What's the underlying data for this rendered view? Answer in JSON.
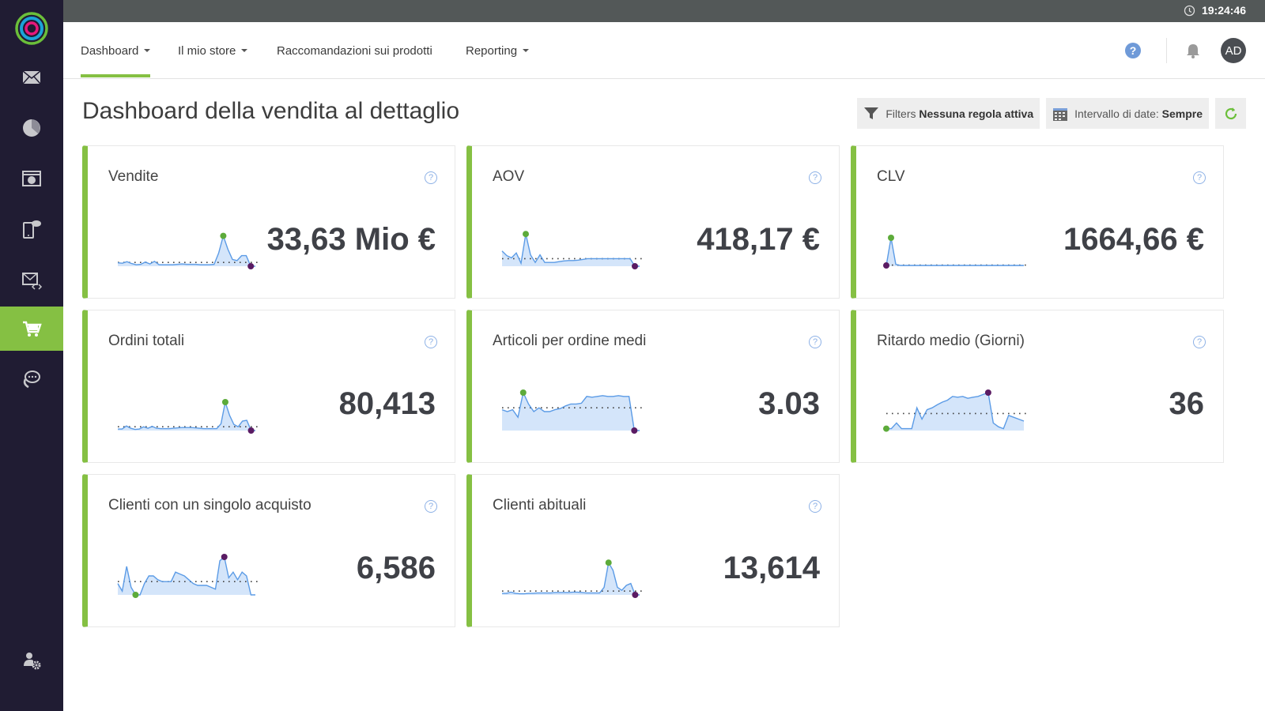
{
  "sidebar": {
    "items": [
      {
        "name": "email",
        "icon": "envelope-icon"
      },
      {
        "name": "analytics",
        "icon": "pie-chart-icon"
      },
      {
        "name": "web-overlay",
        "icon": "browser-window-icon"
      },
      {
        "name": "mobile-push",
        "icon": "mobile-message-icon"
      },
      {
        "name": "email-code",
        "icon": "envelope-code-icon"
      },
      {
        "name": "ecommerce",
        "icon": "cart-icon",
        "active": true
      },
      {
        "name": "chat",
        "icon": "chat-bubble-icon"
      }
    ],
    "bottom": {
      "name": "user-settings",
      "icon": "user-gear-icon"
    }
  },
  "topbar": {
    "time": "19:24:46"
  },
  "nav": {
    "items": [
      {
        "label": "Dashboard",
        "dropdown": true,
        "active": true
      },
      {
        "label": "Il mio store",
        "dropdown": true
      },
      {
        "label": "Raccomandazioni sui prodotti",
        "dropdown": false
      },
      {
        "label": "Reporting",
        "dropdown": true
      }
    ],
    "help": "?",
    "avatar": "AD"
  },
  "page": {
    "title": "Dashboard della vendita al dettaglio",
    "filters_label": "Filters",
    "filters_value": "Nessuna regola attiva",
    "date_label": "Intervallo di date:",
    "date_value": "Sempre"
  },
  "colors": {
    "accent": "#85c043",
    "sidebar": "#201c33",
    "line": "#5b9be6",
    "area": "#d4e5fa",
    "max_dot": "#5dab3a",
    "min_dot": "#5a1b63"
  },
  "cards": [
    {
      "title": "Vendite",
      "value": "33,63 Mio €",
      "avg": 10,
      "max_color": "green",
      "series": [
        9,
        8,
        12,
        7,
        4,
        5,
        11,
        6,
        13,
        4,
        4,
        4,
        4,
        5,
        6,
        5,
        5,
        5,
        4,
        4,
        4,
        5,
        35,
        80,
        45,
        18,
        15,
        28,
        28,
        0,
        0
      ]
    },
    {
      "title": "AOV",
      "value": "418,17 €",
      "avg": 20,
      "max_color": "green",
      "series": [
        40,
        28,
        22,
        35,
        8,
        85,
        30,
        10,
        30,
        10,
        10,
        10,
        12,
        14,
        15,
        15,
        16,
        18,
        20,
        20,
        20,
        20,
        20,
        20,
        20,
        20,
        20,
        20,
        0,
        0
      ]
    },
    {
      "title": "CLV",
      "value": "1664,66 €",
      "avg": 3,
      "max_color": "green",
      "series": [
        2,
        75,
        5,
        2,
        2,
        2,
        2,
        2,
        2,
        2,
        2,
        2,
        2,
        2,
        2,
        2,
        2,
        2,
        2,
        2,
        2,
        2,
        2,
        2,
        2,
        2,
        2,
        2,
        2,
        2
      ]
    },
    {
      "title": "Ordini totali",
      "value": "80,413",
      "avg": 10,
      "max_color": "green",
      "series": [
        4,
        4,
        12,
        6,
        3,
        4,
        10,
        6,
        11,
        6,
        5,
        5,
        5,
        6,
        7,
        8,
        8,
        8,
        7,
        6,
        5,
        5,
        5,
        5,
        18,
        75,
        40,
        16,
        10,
        25,
        27,
        0,
        0
      ]
    },
    {
      "title": "Articoli per ordine medi",
      "value": "3.03",
      "avg": 60,
      "max_color": "green",
      "series": [
        55,
        50,
        55,
        35,
        100,
        70,
        50,
        60,
        50,
        50,
        55,
        58,
        65,
        70,
        70,
        72,
        90,
        88,
        90,
        92,
        90,
        90,
        92,
        90,
        90,
        0,
        0
      ]
    },
    {
      "title": "Ritardo medio (Giorni)",
      "value": "36",
      "avg": 45,
      "max_color": "purple",
      "invert": true,
      "series": [
        5,
        5,
        20,
        5,
        5,
        5,
        60,
        30,
        55,
        60,
        68,
        75,
        80,
        90,
        88,
        90,
        85,
        88,
        90,
        95,
        100,
        20,
        10,
        5,
        40,
        35,
        30,
        25
      ]
    },
    {
      "title": "Clienti con un singolo acquisto",
      "value": "6,586",
      "avg": 35,
      "max_color": "purple",
      "invert": true,
      "series": [
        30,
        10,
        75,
        20,
        0,
        0,
        30,
        50,
        50,
        40,
        35,
        35,
        35,
        60,
        55,
        50,
        40,
        30,
        25,
        25,
        25,
        20,
        15,
        90,
        100,
        45,
        60,
        40,
        60,
        50,
        0,
        0
      ]
    },
    {
      "title": "Clienti abituali",
      "value": "13,614",
      "avg": 10,
      "max_color": "green",
      "series": [
        4,
        4,
        7,
        4,
        3,
        3,
        4,
        4,
        5,
        5,
        5,
        5,
        6,
        6,
        6,
        6,
        7,
        7,
        6,
        5,
        5,
        5,
        5,
        20,
        85,
        65,
        20,
        12,
        25,
        30,
        0,
        0
      ]
    }
  ],
  "card_help": "?"
}
